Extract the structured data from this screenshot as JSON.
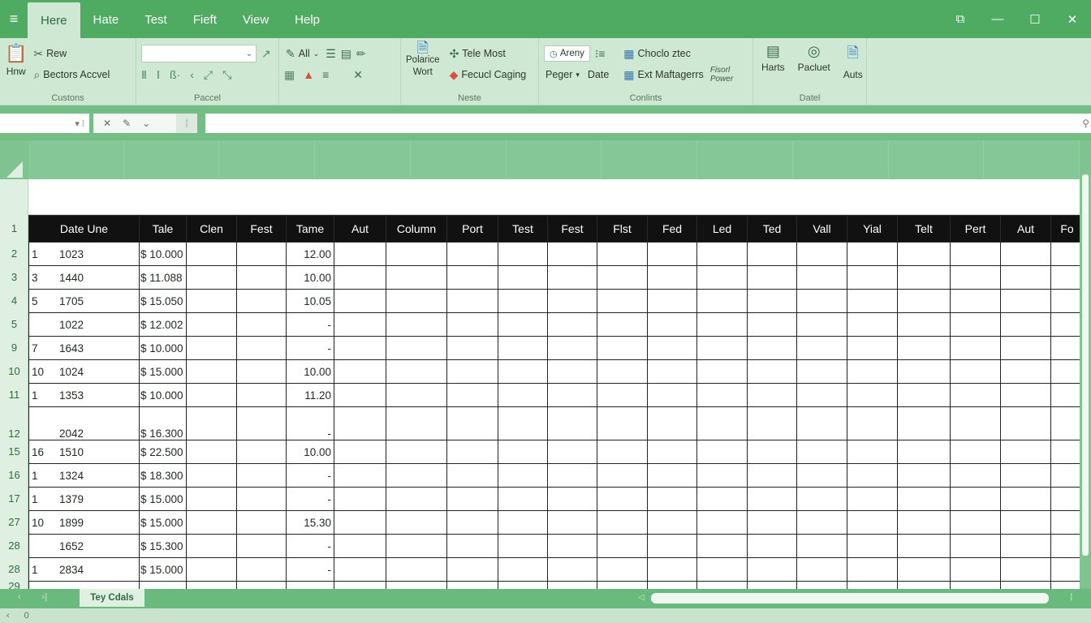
{
  "titlebar": {
    "menu_icon": "hamburger-icon",
    "tabs": [
      {
        "label": "Here",
        "active": true
      },
      {
        "label": "Hate",
        "active": false
      },
      {
        "label": "Test",
        "active": false
      },
      {
        "label": "Fieft",
        "active": false
      },
      {
        "label": "View",
        "active": false
      },
      {
        "label": "Help",
        "active": false
      }
    ]
  },
  "ribbon": {
    "g1": {
      "paste_label": "Hnw",
      "rew_label": "Rew",
      "bectors_label": "Bectors Accvel",
      "group_label": "Custons"
    },
    "g2": {
      "group_label": "Paccel"
    },
    "g3": {
      "all_label": "All"
    },
    "g4": {
      "polartce_label": "Polarice",
      "wort_label": "Wort",
      "tele_most_label": "Tele Most",
      "fecud_label": "Fecucl Caging",
      "group_label": "Neste"
    },
    "g5": {
      "areny_label": "Areny",
      "peger_label": "Peger",
      "date_label": "Date",
      "choclo_label": "Choclo ztec",
      "ext_label": "Ext Maftagerrs",
      "fisori_label": "Fisorl",
      "power_label": "Power",
      "group_label": "Conlints"
    },
    "g6": {
      "harts_label": "Harts",
      "pacluet_label": "Pacluet",
      "auts_label": "Auts",
      "group_label": "Datel"
    }
  },
  "formula_bar": {
    "name_box": "",
    "formula": ""
  },
  "sheet": {
    "columns": [
      "Date Une",
      "Tale",
      "Clen",
      "Fest",
      "Tame",
      "Aut",
      "Column",
      "Port",
      "Test",
      "Fest",
      "Flst",
      "Fed",
      "Led",
      "Ted",
      "Vall",
      "Yial",
      "Telt",
      "Pert",
      "Aut",
      "Fo"
    ],
    "row_numbers": [
      "1",
      "2",
      "3",
      "4",
      "5",
      "9",
      "10",
      "11",
      "12",
      "15",
      "16",
      "17",
      "27",
      "28",
      "28",
      "29"
    ],
    "rows": [
      {
        "a": "1",
        "b": "1023",
        "tale": "$ 10.000",
        "tame": "12.00"
      },
      {
        "a": "3",
        "b": "1440",
        "tale": "$ 11.088",
        "tame": "10.00"
      },
      {
        "a": "5",
        "b": "1705",
        "tale": "$ 15.050",
        "tame": "10.05"
      },
      {
        "a": "",
        "b": "1022",
        "tale": "$ 12.002",
        "tame": "-"
      },
      {
        "a": "7",
        "b": "1643",
        "tale": "$ 10.000",
        "tame": "-"
      },
      {
        "a": "10",
        "b": "1024",
        "tale": "$ 15.000",
        "tame": "10.00"
      },
      {
        "a": "1",
        "b": "1353",
        "tale": "$ 10.000",
        "tame": "11.20"
      },
      {
        "a": "",
        "b": "2042",
        "tale": "$ 16.300",
        "tame": "-"
      },
      {
        "a": "16",
        "b": "1510",
        "tale": "$ 22.500",
        "tame": "10.00"
      },
      {
        "a": "1",
        "b": "1324",
        "tale": "$ 18.300",
        "tame": "-"
      },
      {
        "a": "1",
        "b": "1379",
        "tale": "$ 15.000",
        "tame": "-"
      },
      {
        "a": "10",
        "b": "1899",
        "tale": "$ 15.000",
        "tame": "15.30"
      },
      {
        "a": "",
        "b": "1652",
        "tale": "$ 15.300",
        "tame": "-"
      },
      {
        "a": "1",
        "b": "2834",
        "tale": "$ 15.000",
        "tame": "-"
      }
    ]
  },
  "tabs_bar": {
    "sheet_tab": "Tey Cdals"
  },
  "status": {
    "left": "‹",
    "right": "0"
  },
  "colors": {
    "title_green": "#4faa62",
    "ribbon": "#cfe8d3",
    "header_black": "#111111"
  }
}
